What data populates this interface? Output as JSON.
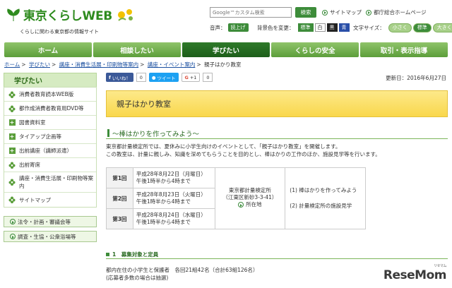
{
  "header": {
    "logo_text": "東京くらしWEB",
    "tagline": "くらしに関わる東京都の情報サイト",
    "search_placeholder": "Google™カスタム検索",
    "search_button": "検索",
    "sitemap_link": "サイトマップ",
    "tocho_link": "都庁総合ホームページ",
    "voice_label": "音声：",
    "voice_button": "読上げ",
    "bg_label": "背景色を変更：",
    "bg_options": [
      "標準",
      "白",
      "黒",
      "青"
    ],
    "fontsize_label": "文字サイズ：",
    "fontsize_options": [
      "小さく",
      "標準",
      "大きく"
    ]
  },
  "nav": {
    "items": [
      "ホーム",
      "相談したい",
      "学びたい",
      "くらしの安全",
      "取引・表示指導"
    ],
    "active_index": 2
  },
  "breadcrumb": [
    "ホーム",
    "学びたい",
    "講座・消費生活展・印刷物等案内",
    "講座・イベント案内",
    "親子はかり教室"
  ],
  "sidebar": {
    "heading": "学びたい",
    "items": [
      {
        "label": "消費者教育読本WEB版",
        "icon": "flower-icon"
      },
      {
        "label": "都作成消費者教育用DVD等",
        "icon": "flower-icon"
      },
      {
        "label": "図書資料室",
        "icon": "plus-square-icon"
      },
      {
        "label": "タイアップ企画等",
        "icon": "plus-square-icon"
      },
      {
        "label": "出前講座（講師派遣）",
        "icon": "plus-square-icon"
      },
      {
        "label": "出前寄席",
        "icon": "flower-icon"
      },
      {
        "label": "講座・消費生活展・印刷物等案内",
        "icon": "flower-icon"
      },
      {
        "label": "サイトマップ",
        "icon": "flower-icon"
      }
    ],
    "bottom_links": [
      "法令・計画・審議会等",
      "調査・生協・公衆浴場等"
    ]
  },
  "social": {
    "fb_label": "いいね！",
    "fb_count": "0",
    "tw_label": "ツイート",
    "gp_label": "+1",
    "gp_count": "0"
  },
  "main": {
    "updated": "更新日：2016年6月27日",
    "title": "親子はかり教室",
    "subtitle": "～棒はかりを作ってみよう～",
    "intro_lines": [
      "東京都計量検定所では、夏休みに小学生向けのイベントとして、「親子はかり教室」を開催します。",
      "この教室は、計量に親しみ、知識を深めてもらうことを目的とし、棒はかりの工作のほか、施設見学等を行います。"
    ],
    "schedule": [
      {
        "num": "第1回",
        "date": "平成28年8月22日（月曜日）",
        "time": "午後1時半から4時まで"
      },
      {
        "num": "第2回",
        "date": "平成28年8月23日（火曜日）",
        "time": "午後1時半から4時まで"
      },
      {
        "num": "第3回",
        "date": "平成28年8月24日（水曜日）",
        "time": "午後1時半から4時まで"
      }
    ],
    "location": {
      "name": "東京都計量検定所",
      "address": "（江東区新砂3-3-41）",
      "link": "所在地"
    },
    "contents": [
      "(1) 棒はかりを作ってみよう",
      "(2) 計量検定所の施設見学"
    ],
    "section1_heading": "1　募集対象と定員",
    "section1_lines": [
      "都内在住の小学生と保護者　各回21組42名（合計63組126名）",
      "(応募者多数の場合は抽選)"
    ]
  },
  "watermark": {
    "text": "ReseMom",
    "sub": "リセマム"
  }
}
